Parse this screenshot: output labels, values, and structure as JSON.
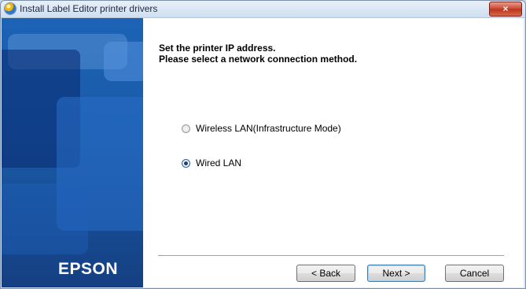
{
  "window": {
    "title": "Install Label Editor printer drivers",
    "close_label": "×"
  },
  "sidebar": {
    "brand": "EPSON"
  },
  "content": {
    "heading_line1": "Set the printer IP address.",
    "heading_line2": "Please select a network connection method.",
    "options": [
      {
        "label": "Wireless LAN(Infrastructure Mode)",
        "selected": false
      },
      {
        "label": "Wired LAN",
        "selected": true
      }
    ]
  },
  "buttons": {
    "back": "< Back",
    "next": "Next >",
    "cancel": "Cancel"
  }
}
